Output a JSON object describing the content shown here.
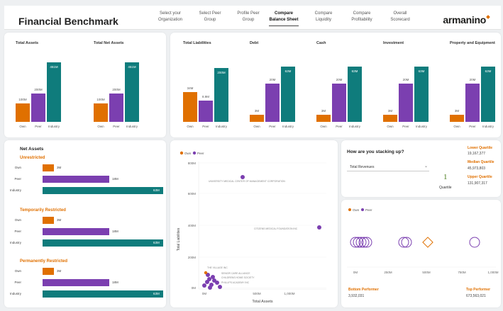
{
  "header": {
    "title": "Financial Benchmark",
    "logo": "armanino",
    "nav": [
      {
        "l1": "Select your",
        "l2": "Organization"
      },
      {
        "l1": "Select Peer",
        "l2": "Group"
      },
      {
        "l1": "Profile Peer",
        "l2": "Group"
      },
      {
        "l1": "Compare",
        "l2": "Balance Sheet",
        "active": true
      },
      {
        "l1": "Compare",
        "l2": "Liquidity"
      },
      {
        "l1": "Compare",
        "l2": "Profitability"
      },
      {
        "l1": "Overall",
        "l2": "Scorecard"
      }
    ]
  },
  "colors": {
    "own": "#e07000",
    "peer": "#7b3fb0",
    "industry": "#0f7c7c"
  },
  "bar_charts": [
    {
      "title": "Total Assets",
      "values": [
        "100M",
        "200M",
        "451M"
      ]
    },
    {
      "title": "Total Net Assets",
      "values": [
        "100M",
        "200M",
        "451M"
      ]
    },
    {
      "title": "Total Liabilities",
      "values": [
        "34M",
        "8.9M",
        "200M"
      ]
    },
    {
      "title": "Debt",
      "values": [
        "3M",
        "20M",
        "63M"
      ]
    },
    {
      "title": "Cash",
      "values": [
        "3M",
        "20M",
        "63M"
      ]
    },
    {
      "title": "Investment",
      "values": [
        "3M",
        "20M",
        "63M"
      ]
    },
    {
      "title": "Property and Equipment",
      "values": [
        "3M",
        "20M",
        "63M"
      ]
    }
  ],
  "bar_xlabels": [
    "Own",
    "Peer",
    "Industry"
  ],
  "net_assets": {
    "title": "Net Assets",
    "sections": [
      {
        "name": "Unrestricted",
        "rows": [
          {
            "label": "Own",
            "value": "3M"
          },
          {
            "label": "Peer",
            "value": "18M"
          },
          {
            "label": "Industry",
            "value": "63M"
          }
        ]
      },
      {
        "name": "Temporarily Restricted",
        "rows": [
          {
            "label": "Own",
            "value": "3M"
          },
          {
            "label": "Peer",
            "value": "18M"
          },
          {
            "label": "Industry",
            "value": "63M"
          }
        ]
      },
      {
        "name": "Permanently Restricted",
        "rows": [
          {
            "label": "Own",
            "value": "3M"
          },
          {
            "label": "Peer",
            "value": "18M"
          },
          {
            "label": "Industry",
            "value": "63M"
          }
        ]
      }
    ]
  },
  "scatter": {
    "legend": [
      "Own",
      "Peer"
    ],
    "ylabel": "Total Liabilities",
    "xlabel": "Total Assets",
    "yticks": [
      "800M",
      "600M",
      "400M",
      "200M",
      "0M"
    ],
    "xticks": [
      "0M",
      "500M",
      "1,000M"
    ],
    "annotations": [
      "UNIVERSITY MEDICAL CENTER OF MANAGEMENT CORPORATION",
      "CITIZENS MEDICAL FOUNDATION INC",
      "SENIOR CARE ALLIANCE",
      "THE VILLAGE INC",
      "CHILDRENS HOME SOCIETY",
      "PHILLIPS ACADEMY INC"
    ]
  },
  "stacking": {
    "title": "How are you stacking up?",
    "dropdown": "Total Revenues",
    "legend": [
      "Own",
      "Peer"
    ],
    "quartile_label": "Quartile",
    "quartile_value": "1",
    "lower_q_label": "Lower Quartile",
    "lower_q_value": "19,167,377",
    "median_q_label": "Median Quartile",
    "median_q_value": "45,973,803",
    "upper_q_label": "Upper Quartile",
    "upper_q_value": "131,907,317",
    "xticks": [
      "0M",
      "250M",
      "500M",
      "750M",
      "1,000M"
    ],
    "bottom_label": "Bottom Performer",
    "bottom_value": "3,932,031",
    "top_label": "Top Performer",
    "top_value": "673,563,021"
  }
}
